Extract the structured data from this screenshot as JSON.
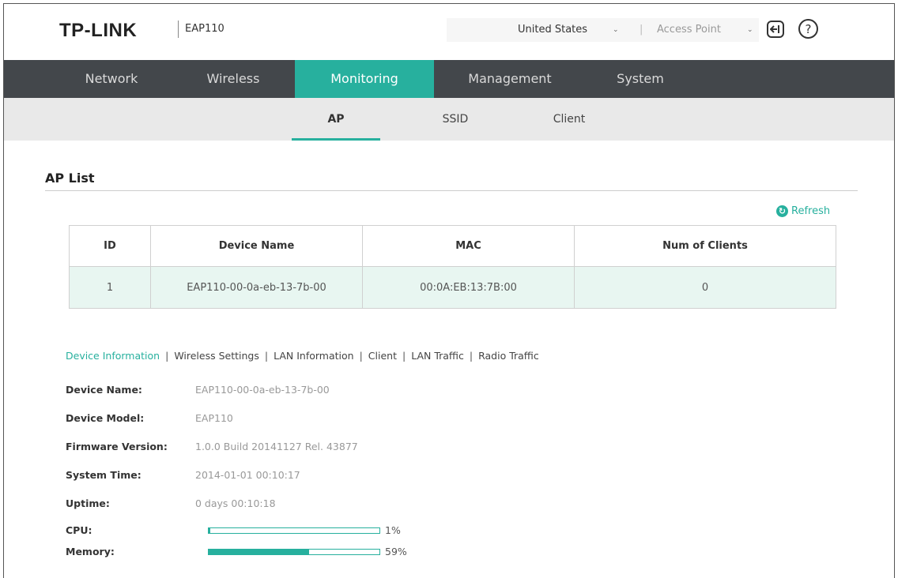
{
  "header": {
    "brand": "TP-LINK",
    "model": "EAP110",
    "country": "United States",
    "mode": "Access Point",
    "separator": "|"
  },
  "main_nav": [
    {
      "label": "Network",
      "active": false
    },
    {
      "label": "Wireless",
      "active": false
    },
    {
      "label": "Monitoring",
      "active": true
    },
    {
      "label": "Management",
      "active": false
    },
    {
      "label": "System",
      "active": false
    }
  ],
  "sub_nav": [
    {
      "label": "AP",
      "active": true
    },
    {
      "label": "SSID",
      "active": false
    },
    {
      "label": "Client",
      "active": false
    }
  ],
  "section": {
    "title": "AP List",
    "refresh_label": "Refresh"
  },
  "ap_table": {
    "headers": [
      "ID",
      "Device Name",
      "MAC",
      "Num of Clients"
    ],
    "rows": [
      [
        "1",
        "EAP110-00-0a-eb-13-7b-00",
        "00:0A:EB:13:7B:00",
        "0"
      ]
    ]
  },
  "detail_tabs": [
    "Device Information",
    "Wireless Settings",
    "LAN Information",
    "Client",
    "LAN Traffic",
    "Radio Traffic"
  ],
  "device_info": [
    {
      "label": "Device Name:",
      "value": "EAP110-00-0a-eb-13-7b-00"
    },
    {
      "label": "Device Model:",
      "value": "EAP110"
    },
    {
      "label": "Firmware Version:",
      "value": "1.0.0 Build 20141127 Rel. 43877"
    },
    {
      "label": "System Time:",
      "value": "2014-01-01 00:10:17"
    },
    {
      "label": "Uptime:",
      "value": "0 days 00:10:18"
    }
  ],
  "usage": [
    {
      "label": "CPU:",
      "percent": 1,
      "text": "1%"
    },
    {
      "label": "Memory:",
      "percent": 59,
      "text": "59%"
    }
  ],
  "colors": {
    "accent": "#27b09e",
    "nav_bg": "#43474b",
    "subnav_bg": "#e9e9e9",
    "row_bg": "#e8f6f1"
  },
  "icons": {
    "logout": "logout-icon",
    "help": "help-icon",
    "refresh": "refresh-icon",
    "dropdown": "chevron-down-icon"
  }
}
